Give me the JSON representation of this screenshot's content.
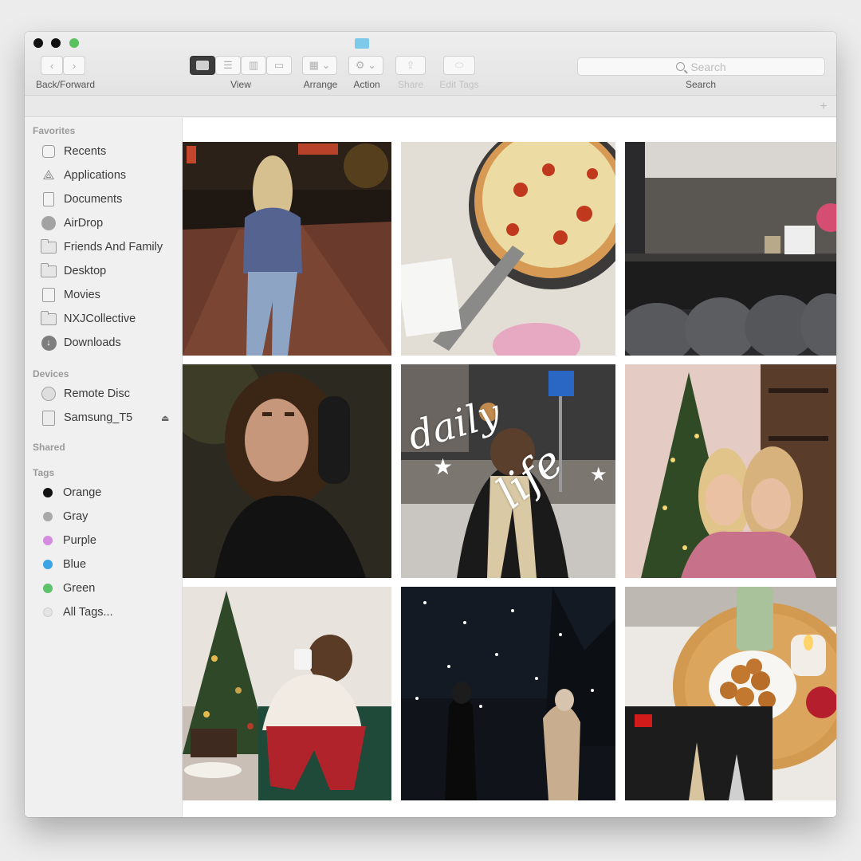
{
  "toolbar": {
    "back_forward_label": "Back/Forward",
    "view_label": "View",
    "arrange_label": "Arrange",
    "action_label": "Action",
    "share_label": "Share",
    "edit_tags_label": "Edit Tags",
    "search_label": "Search",
    "search_placeholder": "Search"
  },
  "sidebar": {
    "favorites_header": "Favorites",
    "favorites": [
      {
        "label": "Recents",
        "icon": "recents-icon"
      },
      {
        "label": "Applications",
        "icon": "applications-icon"
      },
      {
        "label": "Documents",
        "icon": "documents-icon"
      },
      {
        "label": "AirDrop",
        "icon": "airdrop-icon"
      },
      {
        "label": "Friends And Family",
        "icon": "folder-icon"
      },
      {
        "label": "Desktop",
        "icon": "desktop-icon"
      },
      {
        "label": "Movies",
        "icon": "movies-icon"
      },
      {
        "label": "NXJCollective",
        "icon": "folder-icon"
      },
      {
        "label": "Downloads",
        "icon": "downloads-icon"
      }
    ],
    "devices_header": "Devices",
    "devices": [
      {
        "label": "Remote Disc",
        "icon": "disc-icon"
      },
      {
        "label": "Samsung_T5",
        "icon": "drive-icon",
        "eject": "⏏"
      }
    ],
    "shared_header": "Shared",
    "tags_header": "Tags",
    "tags": [
      {
        "label": "Orange",
        "color": "#111111"
      },
      {
        "label": "Gray",
        "color": "#a9a9a9"
      },
      {
        "label": "Purple",
        "color": "#d58be0"
      },
      {
        "label": "Blue",
        "color": "#3aa4e6"
      },
      {
        "label": "Green",
        "color": "#5ec26a"
      },
      {
        "label": "All Tags...",
        "color": "#e4e4e4"
      }
    ]
  },
  "photos": {
    "overlay_word_1": "daily",
    "overlay_word_2": "life",
    "overlay_star": "★"
  },
  "colors": {
    "accent_blue": "#7cc9ea",
    "maximize_green": "#59c25f"
  }
}
